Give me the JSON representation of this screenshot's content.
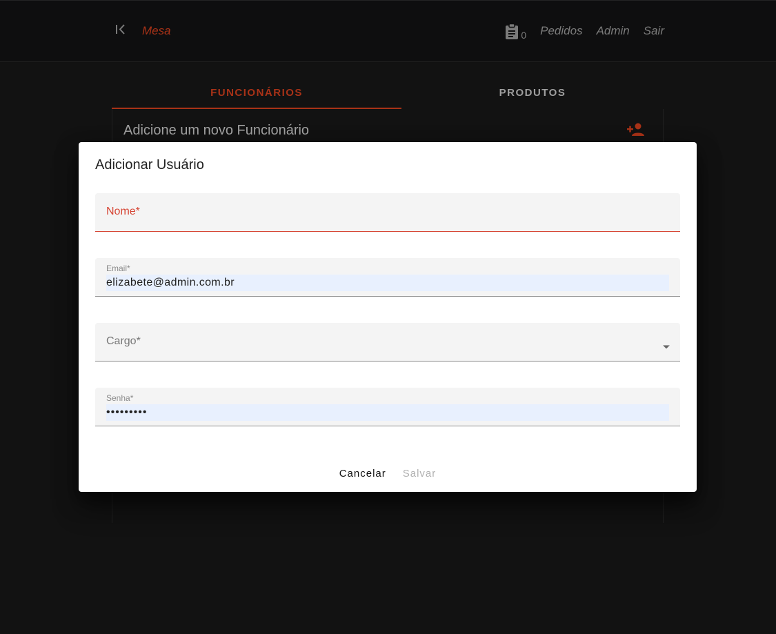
{
  "navbar": {
    "back_icon": "first-page-icon",
    "mesa_label": "Mesa",
    "orders_icon": "clipboard-icon",
    "orders_count": "0",
    "links": [
      "Pedidos",
      "Admin",
      "Sair"
    ]
  },
  "tabs": [
    {
      "label": "FUNCIONÁRIOS",
      "active": true
    },
    {
      "label": "PRODUTOS",
      "active": false
    }
  ],
  "card": {
    "title": "Adicione um novo Funcionário",
    "add_icon": "person-add-icon"
  },
  "dialog": {
    "title": "Adicionar Usuário",
    "fields": {
      "name": {
        "label": "Nome*",
        "value": ""
      },
      "email": {
        "label": "Email*",
        "value": "elizabete@admin.com.br"
      },
      "role": {
        "label": "Cargo*",
        "value": ""
      },
      "password": {
        "label": "Senha*",
        "value": "•••••••••"
      }
    },
    "cancel_label": "Cancelar",
    "save_label": "Salvar"
  },
  "colors": {
    "accent": "#c0391b",
    "error": "#d64534",
    "background": "#151515",
    "navbar": "#111112",
    "autofill": "#e8f0fe"
  }
}
